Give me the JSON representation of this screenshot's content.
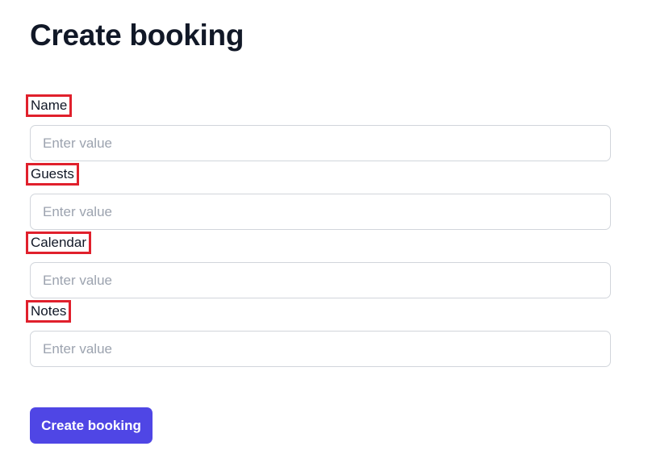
{
  "page": {
    "title": "Create booking"
  },
  "form": {
    "fields": [
      {
        "label": "Name",
        "placeholder": "Enter value",
        "value": ""
      },
      {
        "label": "Guests",
        "placeholder": "Enter value",
        "value": ""
      },
      {
        "label": "Calendar",
        "placeholder": "Enter value",
        "value": ""
      },
      {
        "label": "Notes",
        "placeholder": "Enter value",
        "value": ""
      }
    ],
    "submit_label": "Create booking"
  },
  "colors": {
    "accent": "#4f46e5",
    "highlight_border": "#e0202c",
    "input_border": "#d1d5db",
    "placeholder": "#9ca3af",
    "text": "#111827"
  }
}
